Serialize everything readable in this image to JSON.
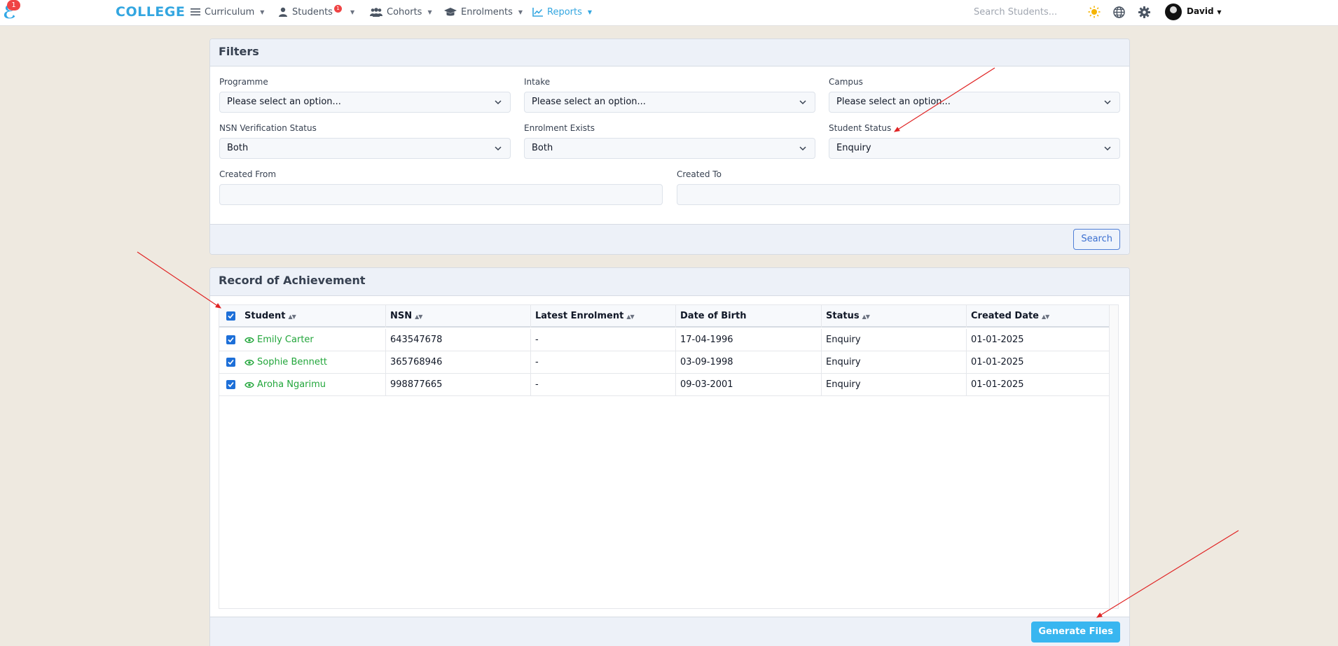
{
  "nav": {
    "logo_badge": "1",
    "brand": "COLLEGE",
    "items": [
      {
        "label": "Curriculum",
        "icon": "menu-icon"
      },
      {
        "label": "Students",
        "icon": "user-icon",
        "badge": "1"
      },
      {
        "label": "Cohorts",
        "icon": "users-icon"
      },
      {
        "label": "Enrolments",
        "icon": "graduation-cap-icon"
      },
      {
        "label": "Reports",
        "icon": "chart-line-icon",
        "active": true
      }
    ],
    "search_placeholder": "Search Students...",
    "user": "David"
  },
  "filters": {
    "title": "Filters",
    "programme": {
      "label": "Programme",
      "value": "Please select an option..."
    },
    "intake": {
      "label": "Intake",
      "value": "Please select an option..."
    },
    "campus": {
      "label": "Campus",
      "value": "Please select an option..."
    },
    "nsn_status": {
      "label": "NSN Verification Status",
      "value": "Both"
    },
    "enrolment_exists": {
      "label": "Enrolment Exists",
      "value": "Both"
    },
    "student_status": {
      "label": "Student Status",
      "value": "Enquiry"
    },
    "created_from": {
      "label": "Created From",
      "value": ""
    },
    "created_to": {
      "label": "Created To",
      "value": ""
    },
    "search_button": "Search"
  },
  "record": {
    "title": "Record of Achievement",
    "columns": [
      "Student",
      "NSN",
      "Latest Enrolment",
      "Date of Birth",
      "Status",
      "Created Date"
    ],
    "rows": [
      {
        "student": "Emily Carter",
        "nsn": "643547678",
        "latest_enrolment": "-",
        "dob": "17-04-1996",
        "status": "Enquiry",
        "created": "01-01-2025"
      },
      {
        "student": "Sophie Bennett",
        "nsn": "365768946",
        "latest_enrolment": "-",
        "dob": "03-09-1998",
        "status": "Enquiry",
        "created": "01-01-2025"
      },
      {
        "student": "Aroha Ngarimu",
        "nsn": "998877665",
        "latest_enrolment": "-",
        "dob": "09-03-2001",
        "status": "Enquiry",
        "created": "01-01-2025"
      }
    ],
    "generate_button": "Generate Files"
  },
  "colors": {
    "brand": "#33a6e0",
    "link_green": "#22a63b",
    "checkbox_blue": "#1d6fd8",
    "annotation_red": "#e02424"
  }
}
